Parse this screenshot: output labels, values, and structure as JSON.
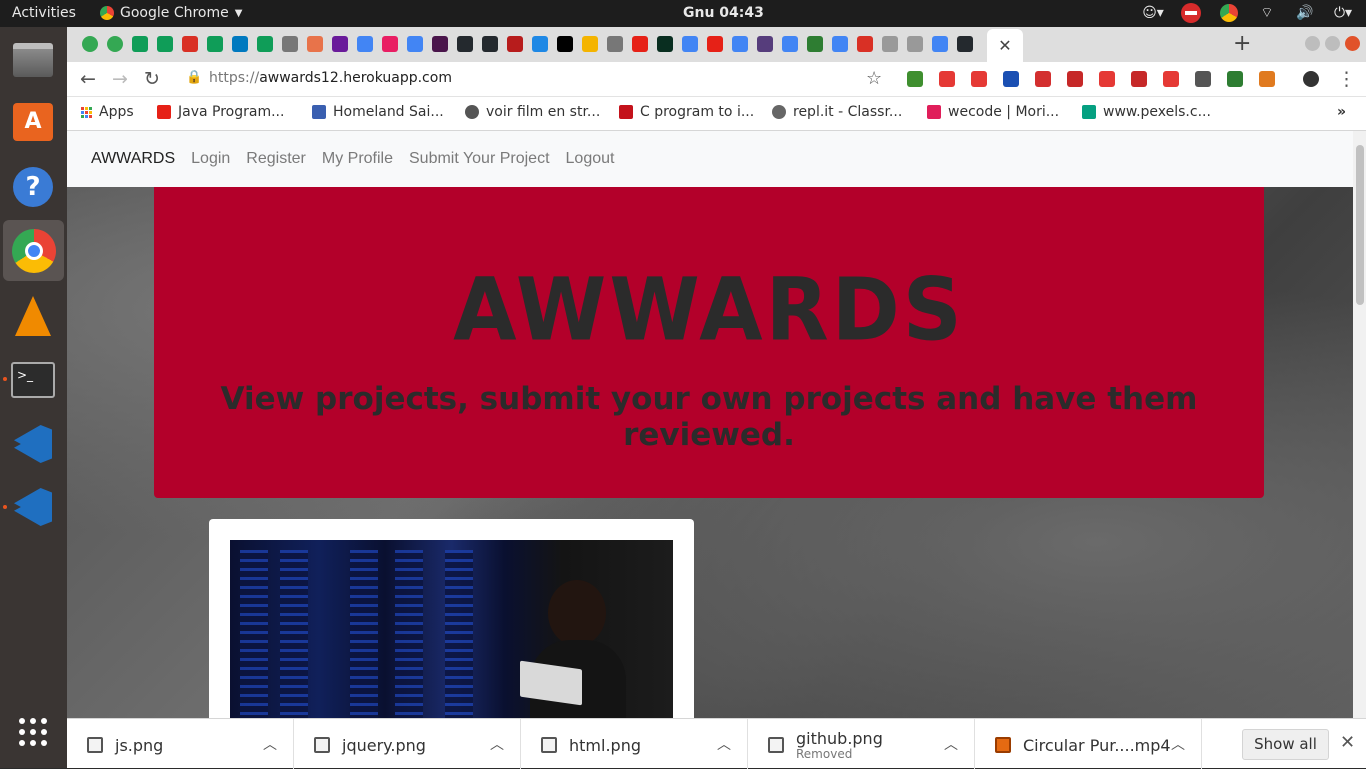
{
  "topbar": {
    "activities": "Activities",
    "app_name": "Google Chrome",
    "clock": "Gnu 04:43"
  },
  "toolbar": {
    "url_scheme": "https://",
    "url_host": "awwards12.herokuapp.com"
  },
  "bookmarks": [
    {
      "label": "Apps",
      "color": "#4285f4"
    },
    {
      "label": "Java Program...",
      "color": "#e62117"
    },
    {
      "label": "Homeland Sai...",
      "color": "#3a5fb0"
    },
    {
      "label": "voir film en str...",
      "color": "#555555"
    },
    {
      "label": "C program to i...",
      "color": "#c4121b"
    },
    {
      "label": "repl.it - Classr...",
      "color": "#666666"
    },
    {
      "label": "wecode | Mori...",
      "color": "#e01e5a"
    },
    {
      "label": "www.pexels.c...",
      "color": "#05a081"
    }
  ],
  "site": {
    "brand": "AWWARDS",
    "nav": [
      "Login",
      "Register",
      "My Profile",
      "Submit Your Project",
      "Logout"
    ],
    "hero_title": "AWWARDS",
    "hero_subtitle": "View projects, submit your own projects and have them reviewed."
  },
  "downloads": [
    {
      "name": "js.png",
      "status": ""
    },
    {
      "name": "jquery.png",
      "status": ""
    },
    {
      "name": "html.png",
      "status": ""
    },
    {
      "name": "github.png",
      "status": "Removed"
    },
    {
      "name": "Circular Pur....mp4",
      "status": ""
    }
  ],
  "shelf": {
    "show_all": "Show all"
  },
  "colors": {
    "hero_bg": "#b3002a",
    "hero_text": "#2b2b2b",
    "navbar_bg": "#f8f9fa"
  }
}
